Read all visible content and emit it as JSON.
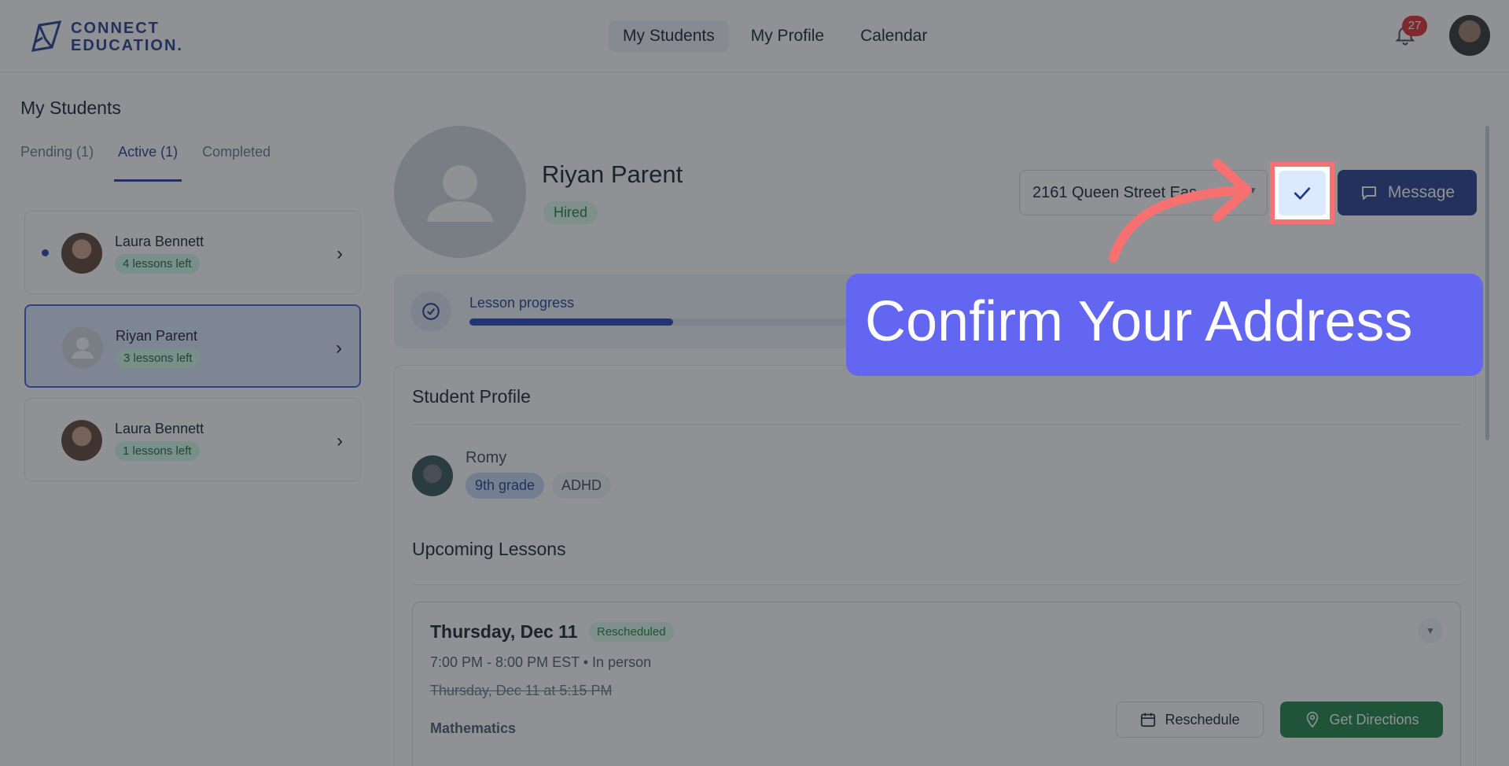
{
  "brand": {
    "line1": "CONNECT",
    "line2": "EDUCATION."
  },
  "nav": {
    "students": "My Students",
    "profile": "My Profile",
    "calendar": "Calendar"
  },
  "notifications": {
    "count": "27"
  },
  "left": {
    "title": "My Students",
    "tabs": [
      "Pending (1)",
      "Active (1)",
      "Completed"
    ],
    "students": [
      {
        "name": "Laura Bennett",
        "lessons": "4 lessons left"
      },
      {
        "name": "Riyan Parent",
        "lessons": "3 lessons left"
      },
      {
        "name": "Laura Bennett",
        "lessons": "1 lessons left"
      }
    ]
  },
  "student": {
    "name": "Riyan Parent",
    "status": "Hired",
    "address": "2161 Queen Street Eas...",
    "message_label": "Message"
  },
  "progress": {
    "label": "Lesson progress",
    "fraction": 0.235
  },
  "profile": {
    "title": "Student Profile",
    "child_name": "Romy",
    "tags": [
      "9th grade",
      "ADHD"
    ]
  },
  "lessons": {
    "title": "Upcoming Lessons",
    "items": [
      {
        "date": "Thursday, Dec 11",
        "status": "Rescheduled",
        "time": "7:00 PM - 8:00 PM EST • In person",
        "previous": "Thursday, Dec 11 at 5:15 PM",
        "subject": "Mathematics",
        "reschedule_label": "Reschedule",
        "directions_label": "Get Directions"
      }
    ]
  },
  "callout": {
    "text": "Confirm Your Address"
  },
  "colors": {
    "accent": "#1e3a8a",
    "callout": "#6366f1",
    "highlight": "#f87171",
    "success": "#15803d"
  }
}
